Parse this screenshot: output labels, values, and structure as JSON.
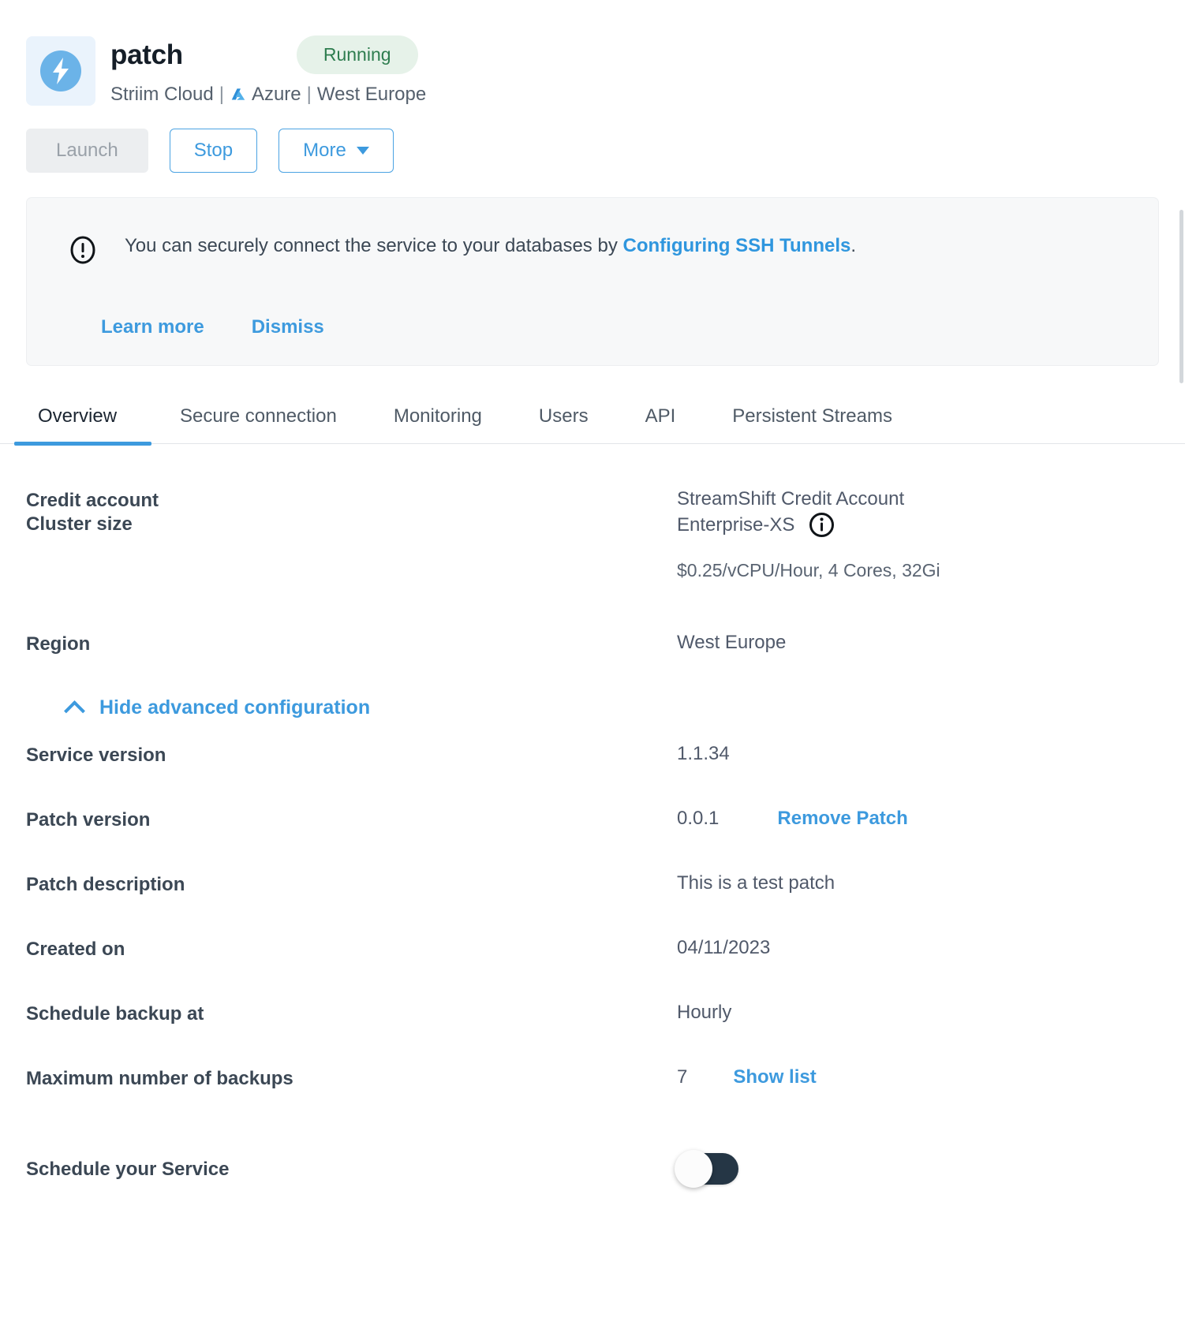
{
  "service": {
    "name": "patch",
    "status": "Running",
    "logo_icon": "bolt-icon",
    "platform": "Striim Cloud",
    "cloud_provider": "Azure",
    "cloud_provider_icon": "azure-icon",
    "region": "West Europe",
    "separator": "|"
  },
  "actions": {
    "launch": "Launch",
    "stop": "Stop",
    "more": "More",
    "more_caret_icon": "chevron-down-icon"
  },
  "banner": {
    "icon": "exclamation-circle-icon",
    "text_before": "You can securely connect the service to your databases by ",
    "link_text": "Configuring SSH Tunnels",
    "text_after": ".",
    "learn_more": "Learn more",
    "dismiss": "Dismiss"
  },
  "tabs": [
    {
      "label": "Overview",
      "active": true
    },
    {
      "label": "Secure connection",
      "active": false
    },
    {
      "label": "Monitoring",
      "active": false
    },
    {
      "label": "Users",
      "active": false
    },
    {
      "label": "API",
      "active": false
    },
    {
      "label": "Persistent Streams",
      "active": false
    }
  ],
  "overview": {
    "credit_account_label": "Credit account",
    "credit_account_value": "StreamShift Credit Account",
    "cluster_size_label": "Cluster size",
    "cluster_size_value": "Enterprise-XS",
    "cluster_size_info_icon": "info-icon",
    "cluster_size_note": "$0.25/vCPU/Hour, 4 Cores, 32Gi",
    "region_label": "Region",
    "region_value": "West Europe",
    "advanced_toggle_label": "Hide advanced configuration",
    "advanced_toggle_icon": "chevron-up-icon",
    "service_version_label": "Service version",
    "service_version_value": "1.1.34",
    "patch_version_label": "Patch version",
    "patch_version_value": "0.0.1",
    "remove_patch_link": "Remove Patch",
    "patch_description_label": "Patch description",
    "patch_description_value": "This is a test patch",
    "created_on_label": "Created on",
    "created_on_value": "04/11/2023",
    "schedule_backup_label": "Schedule backup at",
    "schedule_backup_value": "Hourly",
    "max_backups_label": "Maximum number of backups",
    "max_backups_value": "7",
    "show_list_link": "Show list",
    "schedule_service_label": "Schedule your Service",
    "schedule_service_enabled": false
  },
  "colors": {
    "accent_blue": "#3d9ade",
    "status_green_text": "#2e7d4f",
    "status_green_bg": "#e6f2e9",
    "logo_bg": "#eaf3fc",
    "logo_circle": "#6bb3e8",
    "toggle_track": "#253645",
    "text_primary": "#3b4754",
    "banner_bg": "#f7f8f9"
  }
}
